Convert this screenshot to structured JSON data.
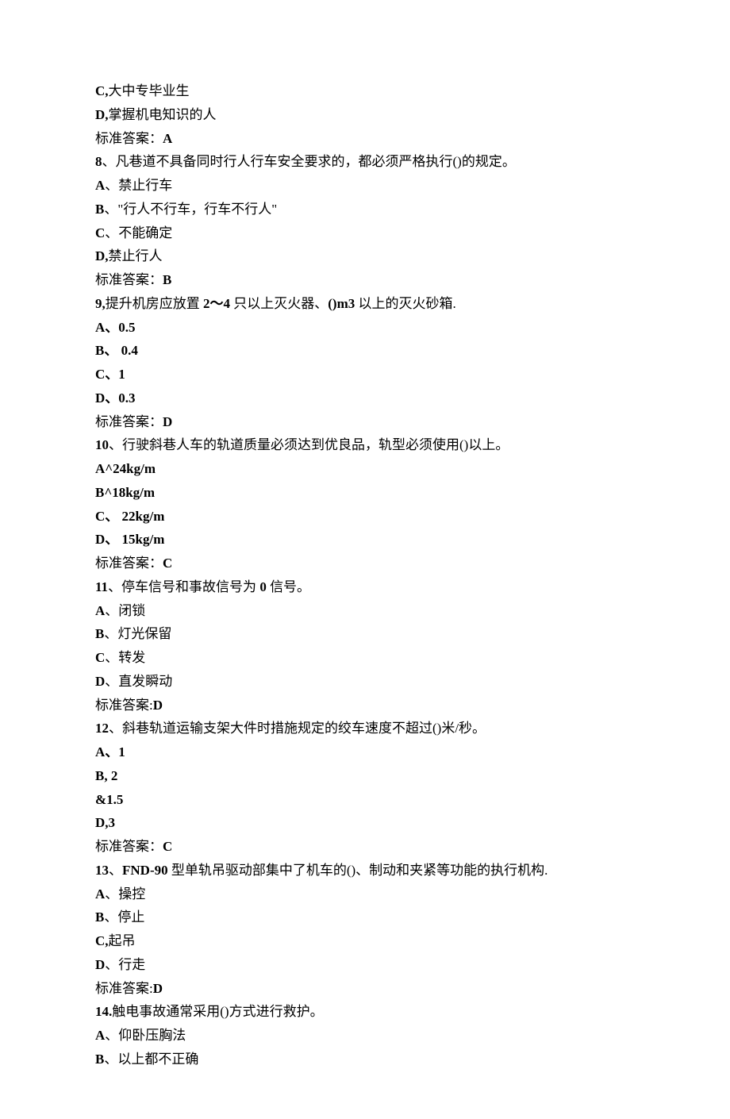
{
  "lines": [
    {
      "text": "C,大中专毕业生",
      "boldPrefix": "C,"
    },
    {
      "text": "D,掌握机电知识的人",
      "boldPrefix": "D,"
    },
    {
      "text": "标准答案：A",
      "boldSuffix": "A"
    },
    {
      "text": "8、凡巷道不具备同时行人行车安全要求的，都必须严格执行()的规定。",
      "boldPrefix": "8"
    },
    {
      "text": "A、禁止行车",
      "boldPrefix": "A"
    },
    {
      "text": "B、\"行人不行车，行车不行人\"",
      "boldPrefix": "B"
    },
    {
      "text": "C、不能确定",
      "boldPrefix": "C"
    },
    {
      "text": "D,禁止行人",
      "boldPrefix": "D,"
    },
    {
      "text": "标准答案：B",
      "boldSuffix": "B"
    },
    {
      "text": "9,提升机房应放置 2〜4 只以上灭火器、()m3 以上的灭火砂箱.",
      "boldParts": [
        "9,",
        "2〜4",
        "()m3"
      ]
    },
    {
      "text": "A、0.5",
      "allBold": true
    },
    {
      "text": "B、 0.4",
      "allBold": true
    },
    {
      "text": "C、1",
      "allBold": true
    },
    {
      "text": "D、0.3",
      "allBold": true
    },
    {
      "text": "标准答案：D",
      "boldSuffix": "D"
    },
    {
      "text": "10、行驶斜巷人车的轨道质量必须达到优良品，轨型必须使用()以上。",
      "boldPrefix": "10"
    },
    {
      "text": "A^24kg/m",
      "allBold": true
    },
    {
      "text": "B^18kg/m",
      "allBold": true
    },
    {
      "text": "C、 22kg/m",
      "allBold": true
    },
    {
      "text": "D、 15kg/m",
      "allBold": true
    },
    {
      "text": "标准答案：C",
      "boldSuffix": "C"
    },
    {
      "text": "11、停车信号和事故信号为 0 信号。",
      "boldParts": [
        "11",
        "0"
      ]
    },
    {
      "text": "A、闭锁",
      "boldPrefix": "A"
    },
    {
      "text": "B、灯光保留",
      "boldPrefix": "B"
    },
    {
      "text": "C、转发",
      "boldPrefix": "C"
    },
    {
      "text": "D、直发瞬动",
      "boldPrefix": "D"
    },
    {
      "text": "标准答案:D",
      "boldSuffix": "D"
    },
    {
      "text": "12、斜巷轨道运输支架大件时措施规定的绞车速度不超过()米/秒。",
      "boldPrefix": "12"
    },
    {
      "text": "A、1",
      "allBold": true
    },
    {
      "text": "B,   2",
      "allBold": true
    },
    {
      "text": "&1.5",
      "allBold": true
    },
    {
      "text": "D,3",
      "allBold": true
    },
    {
      "text": "标准答案：C",
      "boldSuffix": "C"
    },
    {
      "text": "13、FND-90 型单轨吊驱动部集中了机车的()、制动和夹紧等功能的执行机构.",
      "boldParts": [
        "13",
        "FND-90"
      ]
    },
    {
      "text": "A、操控",
      "boldPrefix": "A"
    },
    {
      "text": "B、停止",
      "boldPrefix": "B"
    },
    {
      "text": "C,起吊",
      "boldPrefix": "C,"
    },
    {
      "text": "D、行走",
      "boldPrefix": "D"
    },
    {
      "text": "标准答案:D",
      "boldSuffix": "D"
    },
    {
      "text": "14.触电事故通常采用()方式进行救护。",
      "boldPrefix": "14."
    },
    {
      "text": "A、仰卧压胸法",
      "boldPrefix": "A"
    },
    {
      "text": "B、以上都不正确",
      "boldPrefix": "B"
    }
  ]
}
